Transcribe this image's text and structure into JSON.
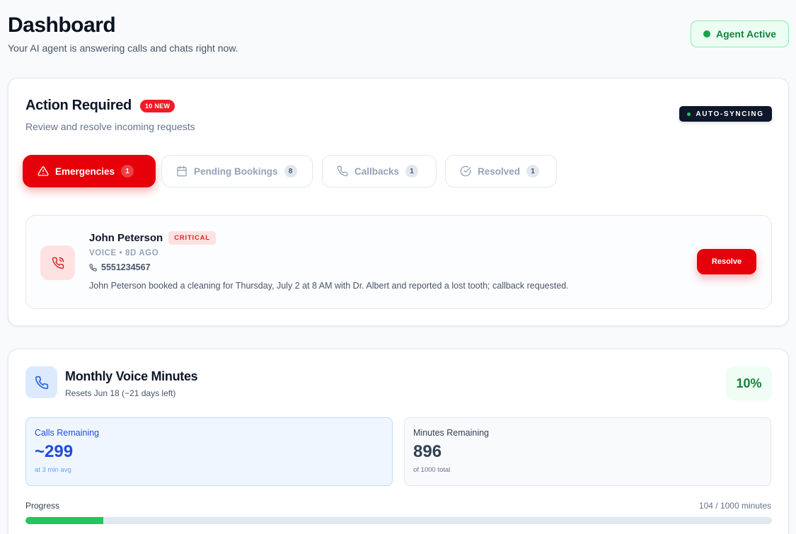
{
  "header": {
    "title": "Dashboard",
    "subtitle": "Your AI agent is answering calls and chats right now.",
    "agent_status": "Agent Active"
  },
  "actions": {
    "title": "Action Required",
    "new_badge": "10 NEW",
    "subtitle": "Review and resolve incoming requests",
    "sync_status": "AUTO-SYNCING",
    "tabs": [
      {
        "label": "Emergencies",
        "count": "1",
        "icon": "alert-triangle-icon",
        "active": true
      },
      {
        "label": "Pending Bookings",
        "count": "8",
        "icon": "calendar-icon",
        "active": false
      },
      {
        "label": "Callbacks",
        "count": "1",
        "icon": "phone-icon",
        "active": false
      },
      {
        "label": "Resolved",
        "count": "1",
        "icon": "check-circle-icon",
        "active": false
      }
    ],
    "items": [
      {
        "name": "John Peterson",
        "severity": "CRITICAL",
        "meta": "VOICE • 8D AGO",
        "phone": "5551234567",
        "summary": "John Peterson booked a cleaning for Thursday, July 2 at 8 AM with Dr. Albert and reported a lost tooth; callback requested.",
        "action_label": "Resolve",
        "icon": "phone-call-icon"
      }
    ]
  },
  "minutes": {
    "title": "Monthly Voice Minutes",
    "subtitle": "Resets Jun 18 (−21 days left)",
    "percent_label": "10%",
    "calls_remaining": {
      "label": "Calls Remaining",
      "value": "~299",
      "note": "at 3 min avg"
    },
    "minutes_remaining": {
      "label": "Minutes Remaining",
      "value": "896",
      "note": "of 1000 total"
    },
    "progress": {
      "label": "Progress",
      "value_text": "104 / 1000 minutes",
      "used": 104,
      "total": 1000
    }
  },
  "colors": {
    "accent_red": "#e6000a",
    "success_green": "#22c55e",
    "info_blue": "#1d4ed8"
  }
}
